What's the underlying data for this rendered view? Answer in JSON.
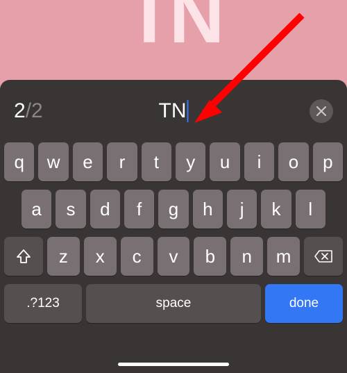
{
  "background": {
    "monogram_text": "TN"
  },
  "input": {
    "counter_current": "2",
    "counter_limit": "/2",
    "value": "TN"
  },
  "keyboard": {
    "row1": [
      "q",
      "w",
      "e",
      "r",
      "t",
      "y",
      "u",
      "i",
      "o",
      "p"
    ],
    "row2": [
      "a",
      "s",
      "d",
      "f",
      "g",
      "h",
      "j",
      "k",
      "l"
    ],
    "row3": [
      "z",
      "x",
      "c",
      "v",
      "b",
      "n",
      "m"
    ],
    "numbers_label": ".?123",
    "space_label": "space",
    "done_label": "done"
  }
}
